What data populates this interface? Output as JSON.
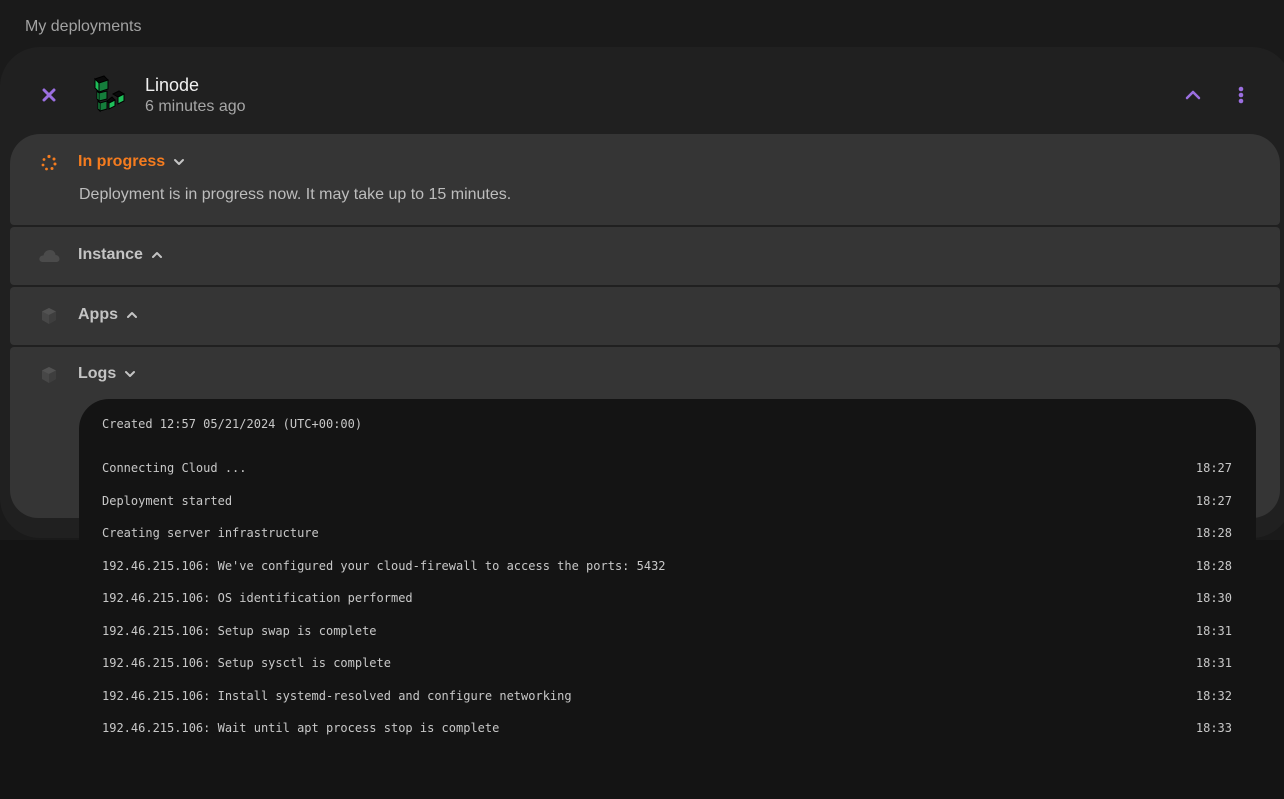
{
  "page": {
    "title": "My deployments"
  },
  "deployment": {
    "name": "Linode",
    "time_ago": "6 minutes ago",
    "accent_color": "#9b6fe0",
    "logo_color": "#1fbf5a"
  },
  "status": {
    "label": "In progress",
    "color": "#f57c1f",
    "description": "Deployment is in progress now. It may take up to 15 minutes."
  },
  "sections": {
    "instance": {
      "label": "Instance",
      "icon": "cloud-icon",
      "chevron": "up"
    },
    "apps": {
      "label": "Apps",
      "icon": "box-icon",
      "chevron": "up"
    },
    "logs": {
      "label": "Logs",
      "icon": "box-icon",
      "chevron": "down"
    }
  },
  "logs": {
    "created": "Created 12:57 05/21/2024 (UTC+00:00)",
    "entries": [
      {
        "message": "Connecting Cloud ...",
        "time": "18:27"
      },
      {
        "message": "Deployment started",
        "time": "18:27"
      },
      {
        "message": "Creating server infrastructure",
        "time": "18:28"
      },
      {
        "message": "192.46.215.106: We've configured your cloud-firewall to access the ports: 5432",
        "time": "18:28"
      },
      {
        "message": "192.46.215.106: OS identification performed",
        "time": "18:30"
      },
      {
        "message": "192.46.215.106: Setup swap is complete",
        "time": "18:31"
      },
      {
        "message": "192.46.215.106: Setup sysctl is complete",
        "time": "18:31"
      },
      {
        "message": "192.46.215.106: Install systemd-resolved and configure networking",
        "time": "18:32"
      },
      {
        "message": "192.46.215.106: Wait until apt process stop is complete",
        "time": "18:33"
      }
    ]
  }
}
